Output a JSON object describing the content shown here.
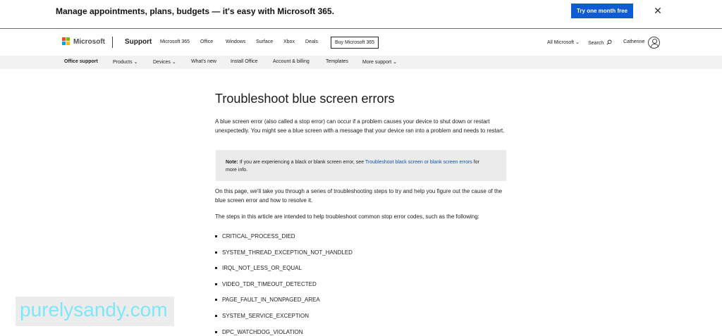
{
  "promo": {
    "text": "Manage appointments, plans, budgets — it's easy with Microsoft 365.",
    "button": "Try one month free",
    "close_icon": "close-icon"
  },
  "header": {
    "brand": "Microsoft",
    "section": "Support",
    "nav": [
      "Microsoft 365",
      "Office",
      "Windows",
      "Surface",
      "Xbox",
      "Deals"
    ],
    "buy_button": "Buy Microsoft 365",
    "all_microsoft": "All Microsoft ⌄",
    "search": "Search",
    "search_icon": "search-icon",
    "user": "Catherine",
    "avatar_icon": "person-icon",
    "logo_colors": [
      "#f25022",
      "#7fba00",
      "#00a4ef",
      "#ffb900"
    ]
  },
  "subnav": {
    "items": [
      "Office support",
      "Products ⌄",
      "Devices ⌄",
      "What's new",
      "Install Office",
      "Account & billing",
      "Templates",
      "More support ⌄"
    ]
  },
  "article": {
    "title": "Troubleshoot blue screen errors",
    "intro": "A blue screen error (also called a stop error) can occur if a problem causes your device to shut down or restart unexpectedly. You might see a blue screen with a message that your device ran into a problem and needs to restart.",
    "note_label": "Note:",
    "note_text": " If you are experiencing a black or blank screen error, see ",
    "note_link": "Troubleshoot black screen or blank screen errors",
    "note_after": " for more info.",
    "para2": "On this page, we'll take you through a series of troubleshooting steps to try and help you figure out the cause of the blue screen error and how to resolve it.",
    "para3": "The steps in this article are intended to help troubleshoot common stop error codes, such as the following:",
    "codes": [
      "CRITICAL_PROCESS_DIED",
      "SYSTEM_THREAD_EXCEPTION_NOT_HANDLED",
      "IRQL_NOT_LESS_OR_EQUAL",
      "VIDEO_TDR_TIMEOUT_DETECTED",
      "PAGE_FAULT_IN_NONPAGED_AREA",
      "SYSTEM_SERVICE_EXCEPTION",
      "DPC_WATCHDOG_VIOLATION"
    ]
  },
  "watermark": "purelysandy.com",
  "colors": {
    "accent": "#0f5bd3",
    "link": "#0b55b8",
    "watermark": "#7fe7f7"
  }
}
